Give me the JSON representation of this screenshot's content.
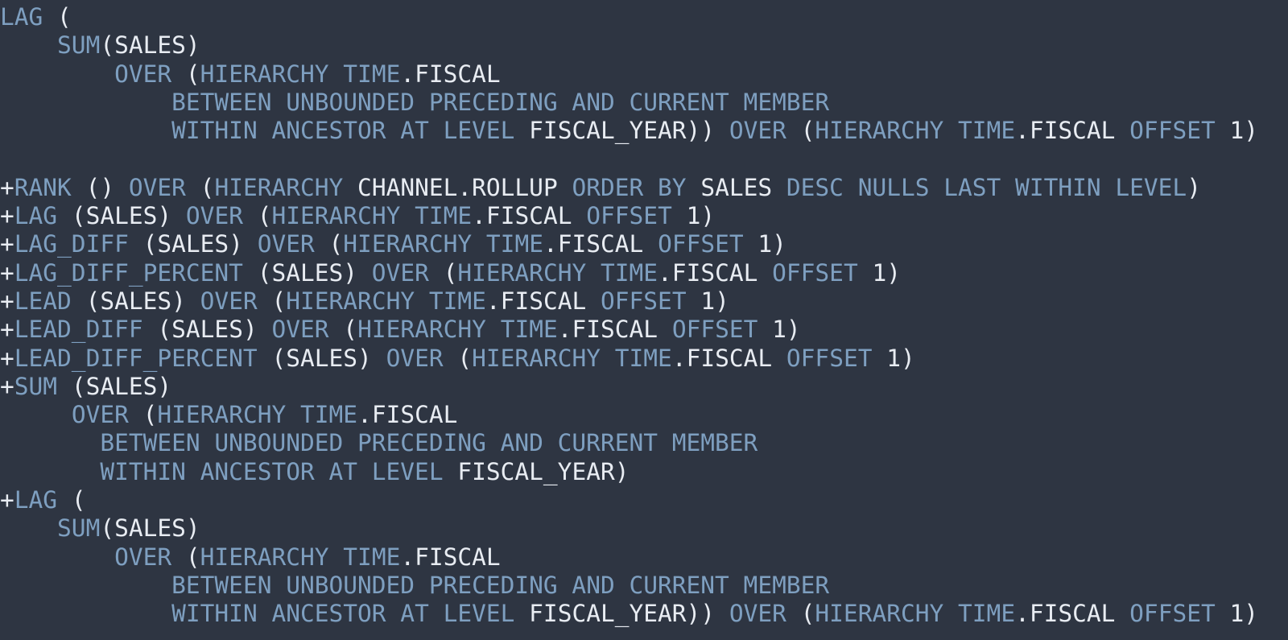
{
  "editor": {
    "name": "sql-code-viewer",
    "background_color": "#2e3542",
    "keyword_color": "#7e9fc0",
    "identifier_color": "#e8ecf2",
    "font_size_px": 29.5,
    "line_height_px": 35.3
  },
  "code": {
    "language": "SQL",
    "full_text": "LAG (\n    SUM(SALES)\n        OVER (HIERARCHY TIME.FISCAL\n            BETWEEN UNBOUNDED PRECEDING AND CURRENT MEMBER\n            WITHIN ANCESTOR AT LEVEL FISCAL_YEAR)) OVER (HIERARCHY TIME.FISCAL OFFSET 1)\n\n+RANK () OVER (HIERARCHY CHANNEL.ROLLUP ORDER BY SALES DESC NULLS LAST WITHIN LEVEL)\n+LAG (SALES) OVER (HIERARCHY TIME.FISCAL OFFSET 1)\n+LAG_DIFF (SALES) OVER (HIERARCHY TIME.FISCAL OFFSET 1)\n+LAG_DIFF_PERCENT (SALES) OVER (HIERARCHY TIME.FISCAL OFFSET 1)\n+LEAD (SALES) OVER (HIERARCHY TIME.FISCAL OFFSET 1)\n+LEAD_DIFF (SALES) OVER (HIERARCHY TIME.FISCAL OFFSET 1)\n+LEAD_DIFF_PERCENT (SALES) OVER (HIERARCHY TIME.FISCAL OFFSET 1)\n+SUM (SALES)\n     OVER (HIERARCHY TIME.FISCAL\n       BETWEEN UNBOUNDED PRECEDING AND CURRENT MEMBER\n       WITHIN ANCESTOR AT LEVEL FISCAL_YEAR)\n+LAG (\n    SUM(SALES)\n        OVER (HIERARCHY TIME.FISCAL\n            BETWEEN UNBOUNDED PRECEDING AND CURRENT MEMBER\n            WITHIN ANCESTOR AT LEVEL FISCAL_YEAR)) OVER (HIERARCHY TIME.FISCAL OFFSET 1)",
    "lines": [
      {
        "index": 1,
        "text": "LAG (",
        "tokens": [
          {
            "t": "LAG",
            "c": "kw"
          },
          {
            "t": " (",
            "c": "pun"
          }
        ]
      },
      {
        "index": 2,
        "text": "    SUM(SALES)",
        "tokens": [
          {
            "t": "    ",
            "c": "pun"
          },
          {
            "t": "SUM",
            "c": "kw"
          },
          {
            "t": "(SALES)",
            "c": "id"
          }
        ]
      },
      {
        "index": 3,
        "text": "        OVER (HIERARCHY TIME.FISCAL",
        "tokens": [
          {
            "t": "        ",
            "c": "pun"
          },
          {
            "t": "OVER",
            "c": "kw"
          },
          {
            "t": " (",
            "c": "pun"
          },
          {
            "t": "HIERARCHY",
            "c": "kw"
          },
          {
            "t": " ",
            "c": "pun"
          },
          {
            "t": "TIME",
            "c": "kw"
          },
          {
            "t": ".FISCAL",
            "c": "id"
          }
        ]
      },
      {
        "index": 4,
        "text": "            BETWEEN UNBOUNDED PRECEDING AND CURRENT MEMBER",
        "tokens": [
          {
            "t": "            ",
            "c": "pun"
          },
          {
            "t": "BETWEEN UNBOUNDED PRECEDING AND CURRENT MEMBER",
            "c": "kw"
          }
        ]
      },
      {
        "index": 5,
        "text": "            WITHIN ANCESTOR AT LEVEL FISCAL_YEAR)) OVER (HIERARCHY TIME.FISCAL OFFSET 1)",
        "tokens": [
          {
            "t": "            ",
            "c": "pun"
          },
          {
            "t": "WITHIN ANCESTOR AT LEVEL",
            "c": "kw"
          },
          {
            "t": " FISCAL_YEAR))",
            "c": "id"
          },
          {
            "t": " ",
            "c": "pun"
          },
          {
            "t": "OVER",
            "c": "kw"
          },
          {
            "t": " (",
            "c": "pun"
          },
          {
            "t": "HIERARCHY",
            "c": "kw"
          },
          {
            "t": " ",
            "c": "pun"
          },
          {
            "t": "TIME",
            "c": "kw"
          },
          {
            "t": ".FISCAL",
            "c": "id"
          },
          {
            "t": " ",
            "c": "pun"
          },
          {
            "t": "OFFSET",
            "c": "kw"
          },
          {
            "t": " 1)",
            "c": "num"
          }
        ]
      },
      {
        "index": 6,
        "text": "",
        "tokens": []
      },
      {
        "index": 7,
        "text": "+RANK () OVER (HIERARCHY CHANNEL.ROLLUP ORDER BY SALES DESC NULLS LAST WITHIN LEVEL)",
        "tokens": [
          {
            "t": "+",
            "c": "plus"
          },
          {
            "t": "RANK",
            "c": "kw"
          },
          {
            "t": " () ",
            "c": "pun"
          },
          {
            "t": "OVER",
            "c": "kw"
          },
          {
            "t": " (",
            "c": "pun"
          },
          {
            "t": "HIERARCHY",
            "c": "kw"
          },
          {
            "t": " CHANNEL.ROLLUP ",
            "c": "id"
          },
          {
            "t": "ORDER BY",
            "c": "kw"
          },
          {
            "t": " SALES ",
            "c": "id"
          },
          {
            "t": "DESC NULLS LAST WITHIN LEVEL",
            "c": "kw"
          },
          {
            "t": ")",
            "c": "pun"
          }
        ]
      },
      {
        "index": 8,
        "text": "+LAG (SALES) OVER (HIERARCHY TIME.FISCAL OFFSET 1)",
        "tokens": [
          {
            "t": "+",
            "c": "plus"
          },
          {
            "t": "LAG",
            "c": "kw"
          },
          {
            "t": " (SALES) ",
            "c": "id"
          },
          {
            "t": "OVER",
            "c": "kw"
          },
          {
            "t": " (",
            "c": "pun"
          },
          {
            "t": "HIERARCHY",
            "c": "kw"
          },
          {
            "t": " ",
            "c": "pun"
          },
          {
            "t": "TIME",
            "c": "kw"
          },
          {
            "t": ".FISCAL",
            "c": "id"
          },
          {
            "t": " ",
            "c": "pun"
          },
          {
            "t": "OFFSET",
            "c": "kw"
          },
          {
            "t": " 1)",
            "c": "num"
          }
        ]
      },
      {
        "index": 9,
        "text": "+LAG_DIFF (SALES) OVER (HIERARCHY TIME.FISCAL OFFSET 1)",
        "tokens": [
          {
            "t": "+",
            "c": "plus"
          },
          {
            "t": "LAG_DIFF",
            "c": "kw"
          },
          {
            "t": " (SALES) ",
            "c": "id"
          },
          {
            "t": "OVER",
            "c": "kw"
          },
          {
            "t": " (",
            "c": "pun"
          },
          {
            "t": "HIERARCHY",
            "c": "kw"
          },
          {
            "t": " ",
            "c": "pun"
          },
          {
            "t": "TIME",
            "c": "kw"
          },
          {
            "t": ".FISCAL",
            "c": "id"
          },
          {
            "t": " ",
            "c": "pun"
          },
          {
            "t": "OFFSET",
            "c": "kw"
          },
          {
            "t": " 1)",
            "c": "num"
          }
        ]
      },
      {
        "index": 10,
        "text": "+LAG_DIFF_PERCENT (SALES) OVER (HIERARCHY TIME.FISCAL OFFSET 1)",
        "tokens": [
          {
            "t": "+",
            "c": "plus"
          },
          {
            "t": "LAG_DIFF_PERCENT",
            "c": "kw"
          },
          {
            "t": " (SALES) ",
            "c": "id"
          },
          {
            "t": "OVER",
            "c": "kw"
          },
          {
            "t": " (",
            "c": "pun"
          },
          {
            "t": "HIERARCHY",
            "c": "kw"
          },
          {
            "t": " ",
            "c": "pun"
          },
          {
            "t": "TIME",
            "c": "kw"
          },
          {
            "t": ".FISCAL",
            "c": "id"
          },
          {
            "t": " ",
            "c": "pun"
          },
          {
            "t": "OFFSET",
            "c": "kw"
          },
          {
            "t": " 1)",
            "c": "num"
          }
        ]
      },
      {
        "index": 11,
        "text": "+LEAD (SALES) OVER (HIERARCHY TIME.FISCAL OFFSET 1)",
        "tokens": [
          {
            "t": "+",
            "c": "plus"
          },
          {
            "t": "LEAD",
            "c": "kw"
          },
          {
            "t": " (SALES) ",
            "c": "id"
          },
          {
            "t": "OVER",
            "c": "kw"
          },
          {
            "t": " (",
            "c": "pun"
          },
          {
            "t": "HIERARCHY",
            "c": "kw"
          },
          {
            "t": " ",
            "c": "pun"
          },
          {
            "t": "TIME",
            "c": "kw"
          },
          {
            "t": ".FISCAL",
            "c": "id"
          },
          {
            "t": " ",
            "c": "pun"
          },
          {
            "t": "OFFSET",
            "c": "kw"
          },
          {
            "t": " 1)",
            "c": "num"
          }
        ]
      },
      {
        "index": 12,
        "text": "+LEAD_DIFF (SALES) OVER (HIERARCHY TIME.FISCAL OFFSET 1)",
        "tokens": [
          {
            "t": "+",
            "c": "plus"
          },
          {
            "t": "LEAD_DIFF",
            "c": "kw"
          },
          {
            "t": " (SALES) ",
            "c": "id"
          },
          {
            "t": "OVER",
            "c": "kw"
          },
          {
            "t": " (",
            "c": "pun"
          },
          {
            "t": "HIERARCHY",
            "c": "kw"
          },
          {
            "t": " ",
            "c": "pun"
          },
          {
            "t": "TIME",
            "c": "kw"
          },
          {
            "t": ".FISCAL",
            "c": "id"
          },
          {
            "t": " ",
            "c": "pun"
          },
          {
            "t": "OFFSET",
            "c": "kw"
          },
          {
            "t": " 1)",
            "c": "num"
          }
        ]
      },
      {
        "index": 13,
        "text": "+LEAD_DIFF_PERCENT (SALES) OVER (HIERARCHY TIME.FISCAL OFFSET 1)",
        "tokens": [
          {
            "t": "+",
            "c": "plus"
          },
          {
            "t": "LEAD_DIFF_PERCENT",
            "c": "kw"
          },
          {
            "t": " (SALES) ",
            "c": "id"
          },
          {
            "t": "OVER",
            "c": "kw"
          },
          {
            "t": " (",
            "c": "pun"
          },
          {
            "t": "HIERARCHY",
            "c": "kw"
          },
          {
            "t": " ",
            "c": "pun"
          },
          {
            "t": "TIME",
            "c": "kw"
          },
          {
            "t": ".FISCAL",
            "c": "id"
          },
          {
            "t": " ",
            "c": "pun"
          },
          {
            "t": "OFFSET",
            "c": "kw"
          },
          {
            "t": " 1)",
            "c": "num"
          }
        ]
      },
      {
        "index": 14,
        "text": "+SUM (SALES)",
        "tokens": [
          {
            "t": "+",
            "c": "plus"
          },
          {
            "t": "SUM",
            "c": "kw"
          },
          {
            "t": " (SALES)",
            "c": "id"
          }
        ]
      },
      {
        "index": 15,
        "text": "     OVER (HIERARCHY TIME.FISCAL",
        "tokens": [
          {
            "t": "     ",
            "c": "pun"
          },
          {
            "t": "OVER",
            "c": "kw"
          },
          {
            "t": " (",
            "c": "pun"
          },
          {
            "t": "HIERARCHY",
            "c": "kw"
          },
          {
            "t": " ",
            "c": "pun"
          },
          {
            "t": "TIME",
            "c": "kw"
          },
          {
            "t": ".FISCAL",
            "c": "id"
          }
        ]
      },
      {
        "index": 16,
        "text": "       BETWEEN UNBOUNDED PRECEDING AND CURRENT MEMBER",
        "tokens": [
          {
            "t": "       ",
            "c": "pun"
          },
          {
            "t": "BETWEEN UNBOUNDED PRECEDING AND CURRENT MEMBER",
            "c": "kw"
          }
        ]
      },
      {
        "index": 17,
        "text": "       WITHIN ANCESTOR AT LEVEL FISCAL_YEAR)",
        "tokens": [
          {
            "t": "       ",
            "c": "pun"
          },
          {
            "t": "WITHIN ANCESTOR AT LEVEL",
            "c": "kw"
          },
          {
            "t": " FISCAL_YEAR)",
            "c": "id"
          }
        ]
      },
      {
        "index": 18,
        "text": "+LAG (",
        "tokens": [
          {
            "t": "+",
            "c": "plus"
          },
          {
            "t": "LAG",
            "c": "kw"
          },
          {
            "t": " (",
            "c": "pun"
          }
        ]
      },
      {
        "index": 19,
        "text": "    SUM(SALES)",
        "tokens": [
          {
            "t": "    ",
            "c": "pun"
          },
          {
            "t": "SUM",
            "c": "kw"
          },
          {
            "t": "(SALES)",
            "c": "id"
          }
        ]
      },
      {
        "index": 20,
        "text": "        OVER (HIERARCHY TIME.FISCAL",
        "tokens": [
          {
            "t": "        ",
            "c": "pun"
          },
          {
            "t": "OVER",
            "c": "kw"
          },
          {
            "t": " (",
            "c": "pun"
          },
          {
            "t": "HIERARCHY",
            "c": "kw"
          },
          {
            "t": " ",
            "c": "pun"
          },
          {
            "t": "TIME",
            "c": "kw"
          },
          {
            "t": ".FISCAL",
            "c": "id"
          }
        ]
      },
      {
        "index": 21,
        "text": "            BETWEEN UNBOUNDED PRECEDING AND CURRENT MEMBER",
        "tokens": [
          {
            "t": "            ",
            "c": "pun"
          },
          {
            "t": "BETWEEN UNBOUNDED PRECEDING AND CURRENT MEMBER",
            "c": "kw"
          }
        ]
      },
      {
        "index": 22,
        "text": "            WITHIN ANCESTOR AT LEVEL FISCAL_YEAR)) OVER (HIERARCHY TIME.FISCAL OFFSET 1)",
        "tokens": [
          {
            "t": "            ",
            "c": "pun"
          },
          {
            "t": "WITHIN ANCESTOR AT LEVEL",
            "c": "kw"
          },
          {
            "t": " FISCAL_YEAR))",
            "c": "id"
          },
          {
            "t": " ",
            "c": "pun"
          },
          {
            "t": "OVER",
            "c": "kw"
          },
          {
            "t": " (",
            "c": "pun"
          },
          {
            "t": "HIERARCHY",
            "c": "kw"
          },
          {
            "t": " ",
            "c": "pun"
          },
          {
            "t": "TIME",
            "c": "kw"
          },
          {
            "t": ".FISCAL",
            "c": "id"
          },
          {
            "t": " ",
            "c": "pun"
          },
          {
            "t": "OFFSET",
            "c": "kw"
          },
          {
            "t": " 1)",
            "c": "num"
          }
        ]
      }
    ]
  }
}
